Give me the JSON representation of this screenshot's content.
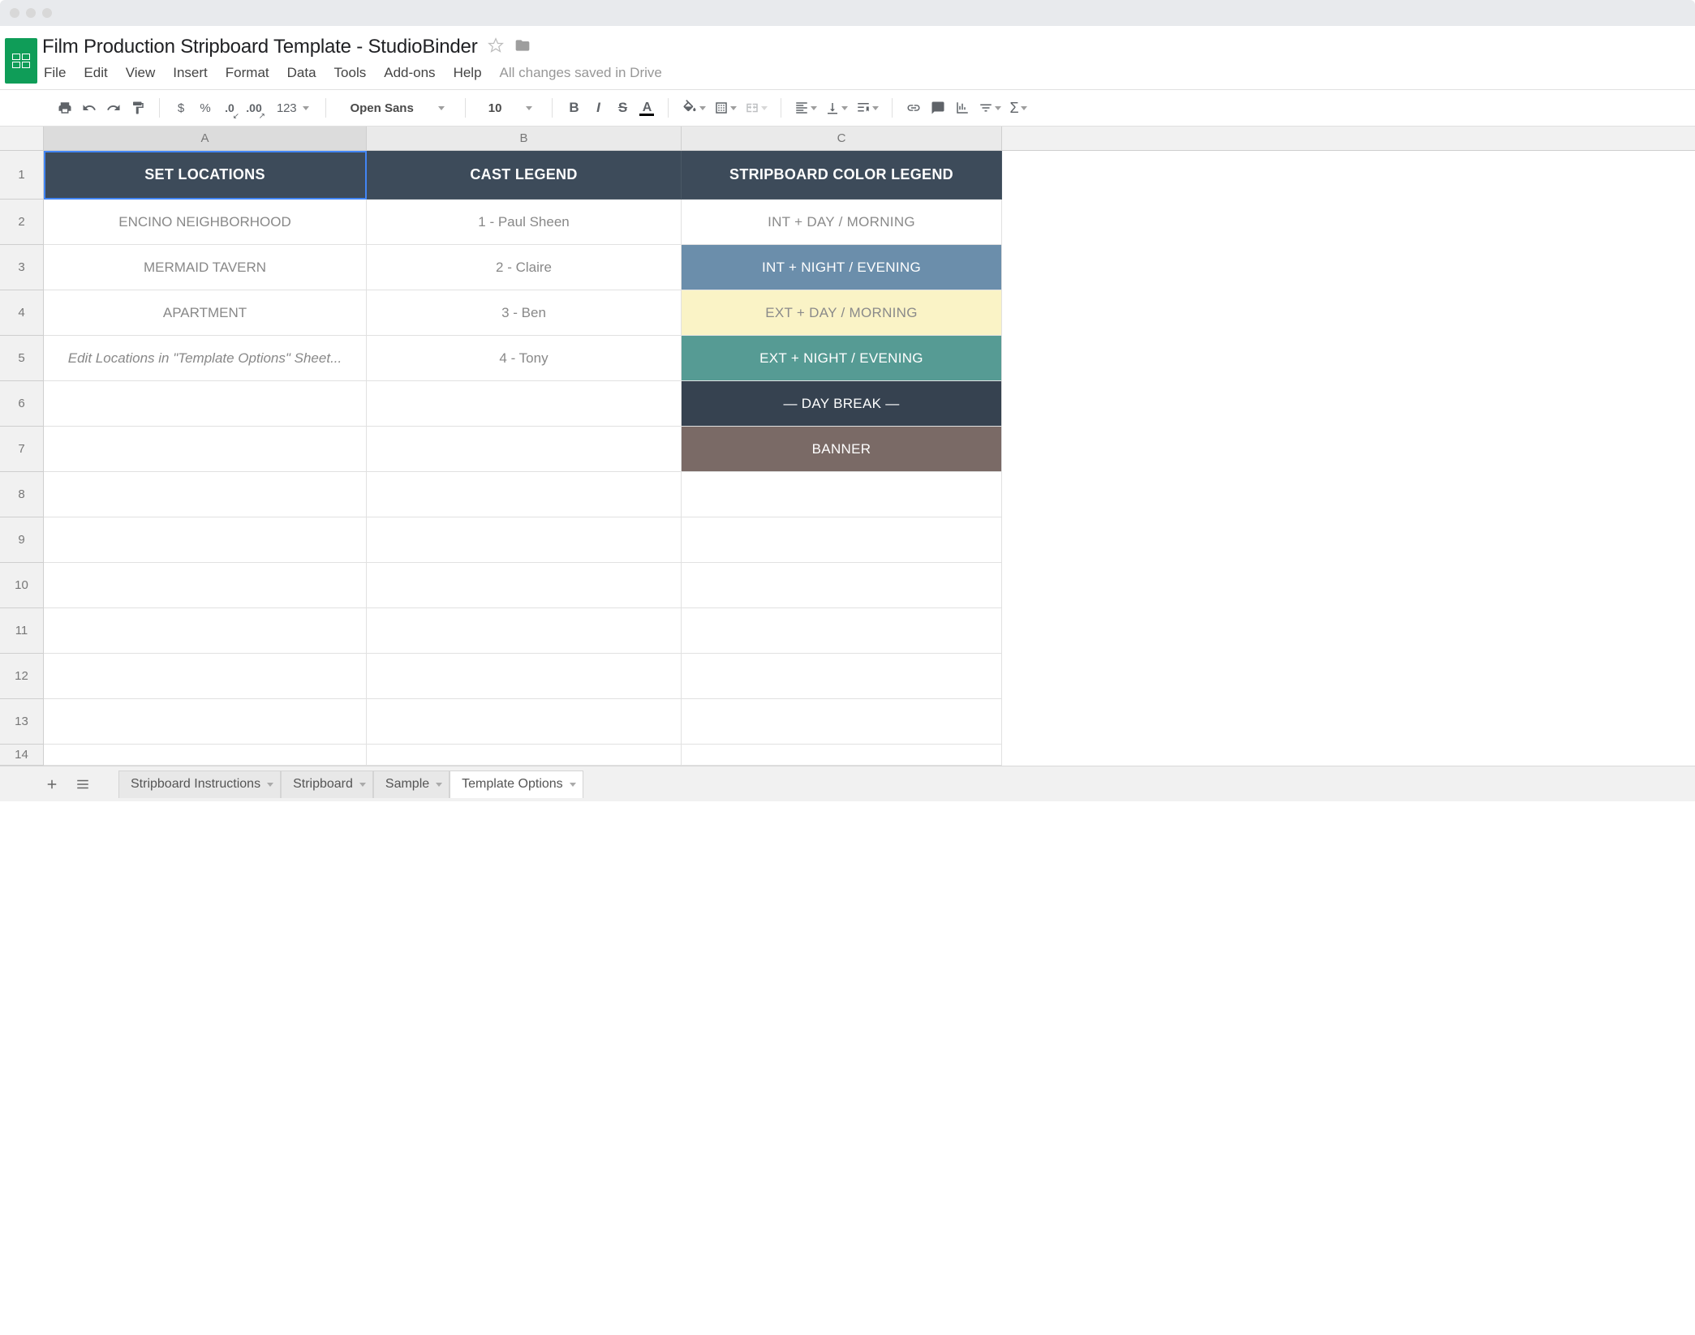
{
  "doc_title": "Film Production Stripboard Template  -  StudioBinder",
  "save_status": "All changes saved in Drive",
  "menus": [
    "File",
    "Edit",
    "View",
    "Insert",
    "Format",
    "Data",
    "Tools",
    "Add-ons",
    "Help"
  ],
  "toolbar": {
    "currency": "$",
    "percent": "%",
    "dec_dec": ".0",
    "dec_inc": ".00",
    "num_format": "123",
    "font": "Open Sans",
    "font_size": "10",
    "bold": "B",
    "italic": "I",
    "strike": "S",
    "text_color": "A",
    "sigma": "Σ"
  },
  "columns": [
    "A",
    "B",
    "C"
  ],
  "row_numbers": [
    "1",
    "2",
    "3",
    "4",
    "5",
    "6",
    "7",
    "8",
    "9",
    "10",
    "11",
    "12",
    "13",
    "14"
  ],
  "headers": {
    "a": "SET LOCATIONS",
    "b": "CAST LEGEND",
    "c": "STRIPBOARD COLOR LEGEND"
  },
  "data": {
    "a": [
      "ENCINO NEIGHBORHOOD",
      "MERMAID TAVERN",
      "APARTMENT",
      "Edit Locations in \"Template Options\" Sheet..."
    ],
    "b": [
      "1 - Paul Sheen",
      "2 - Claire",
      "3 - Ben",
      "4 - Tony"
    ],
    "c": [
      {
        "label": "INT  +  DAY / MORNING",
        "class": "bg-white2"
      },
      {
        "label": "INT  +  NIGHT / EVENING",
        "class": "bg-blue"
      },
      {
        "label": "EXT  +  DAY / MORNING",
        "class": "bg-cream"
      },
      {
        "label": "EXT  +  NIGHT / EVENING",
        "class": "bg-teal"
      },
      {
        "label": "— DAY BREAK —",
        "class": "bg-darknavy"
      },
      {
        "label": "BANNER",
        "class": "bg-brown"
      }
    ]
  },
  "sheets": [
    "Stripboard Instructions",
    "Stripboard",
    "Sample",
    "Template Options"
  ],
  "active_sheet": "Template Options",
  "colors": {
    "header_bg": "#3d4b5a",
    "int_night": "#6b8eab",
    "ext_day": "#faf3c6",
    "ext_night": "#569b94",
    "day_break": "#364250",
    "banner": "#7a6a66",
    "sheets_green": "#0f9d58"
  },
  "chart_data": {
    "type": "table",
    "columns": [
      "SET LOCATIONS",
      "CAST LEGEND",
      "STRIPBOARD COLOR LEGEND"
    ],
    "rows": [
      [
        "ENCINO NEIGHBORHOOD",
        "1 - Paul Sheen",
        "INT  +  DAY / MORNING"
      ],
      [
        "MERMAID TAVERN",
        "2 - Claire",
        "INT  +  NIGHT / EVENING"
      ],
      [
        "APARTMENT",
        "3 - Ben",
        "EXT  +  DAY / MORNING"
      ],
      [
        "Edit Locations in \"Template Options\" Sheet...",
        "4 - Tony",
        "EXT  +  NIGHT / EVENING"
      ],
      [
        "",
        "",
        "— DAY BREAK —"
      ],
      [
        "",
        "",
        "BANNER"
      ]
    ]
  }
}
